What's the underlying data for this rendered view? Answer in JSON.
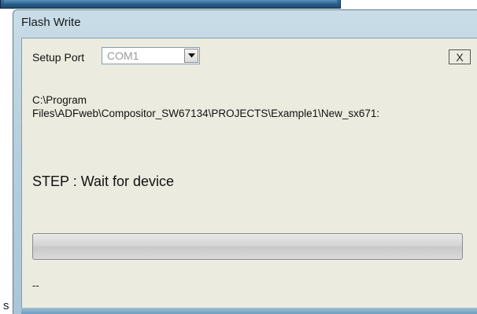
{
  "window": {
    "title": "Flash Write"
  },
  "setup": {
    "label": "Setup Port",
    "port_value": "COM1"
  },
  "close_button": {
    "label": "X"
  },
  "file_path": "C:\\Program\nFiles\\ADFweb\\Compositor_SW67134\\PROJECTS\\Example1\\New_sx671:",
  "step": "STEP : Wait for device",
  "progress": {
    "value": 0
  },
  "status": "--",
  "stray_text": "s"
}
